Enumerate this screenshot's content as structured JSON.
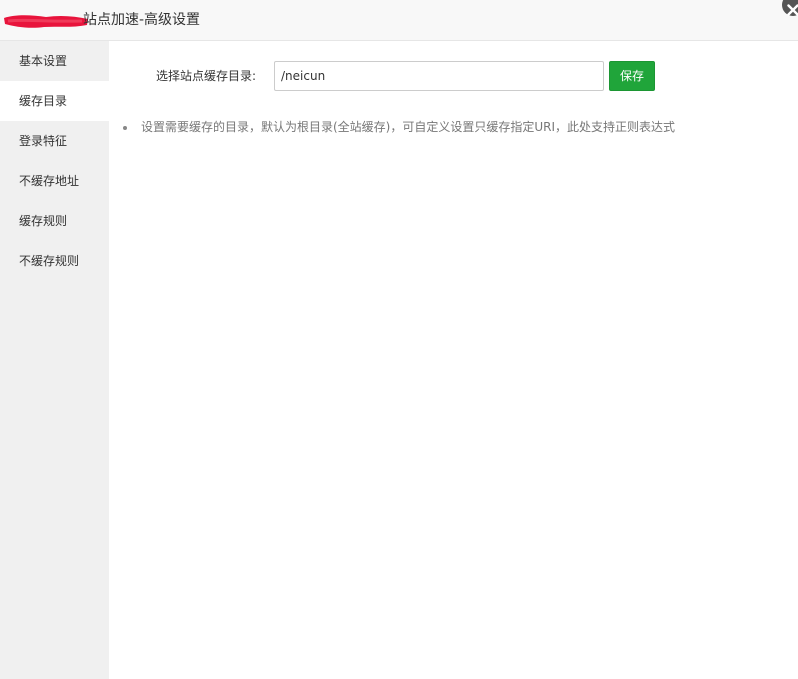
{
  "window": {
    "title": "站点加速-高级设置",
    "close_icon": "close-icon"
  },
  "sidebar": {
    "items": [
      {
        "label": "基本设置",
        "active": false
      },
      {
        "label": "缓存目录",
        "active": true
      },
      {
        "label": "登录特征",
        "active": false
      },
      {
        "label": "不缓存地址",
        "active": false
      },
      {
        "label": "缓存规则",
        "active": false
      },
      {
        "label": "不缓存规则",
        "active": false
      }
    ]
  },
  "main": {
    "form": {
      "label": "选择站点缓存目录:",
      "value": "/neicun",
      "save_label": "保存"
    },
    "help": [
      "设置需要缓存的目录，默认为根目录(全站缓存)，可自定义设置只缓存指定URI，此处支持正则表达式"
    ]
  },
  "colors": {
    "primary_green": "#20a53a",
    "sidebar_bg": "#f0f0f0",
    "header_bg": "#f8f8f8",
    "redaction_red": "#e8143c"
  }
}
